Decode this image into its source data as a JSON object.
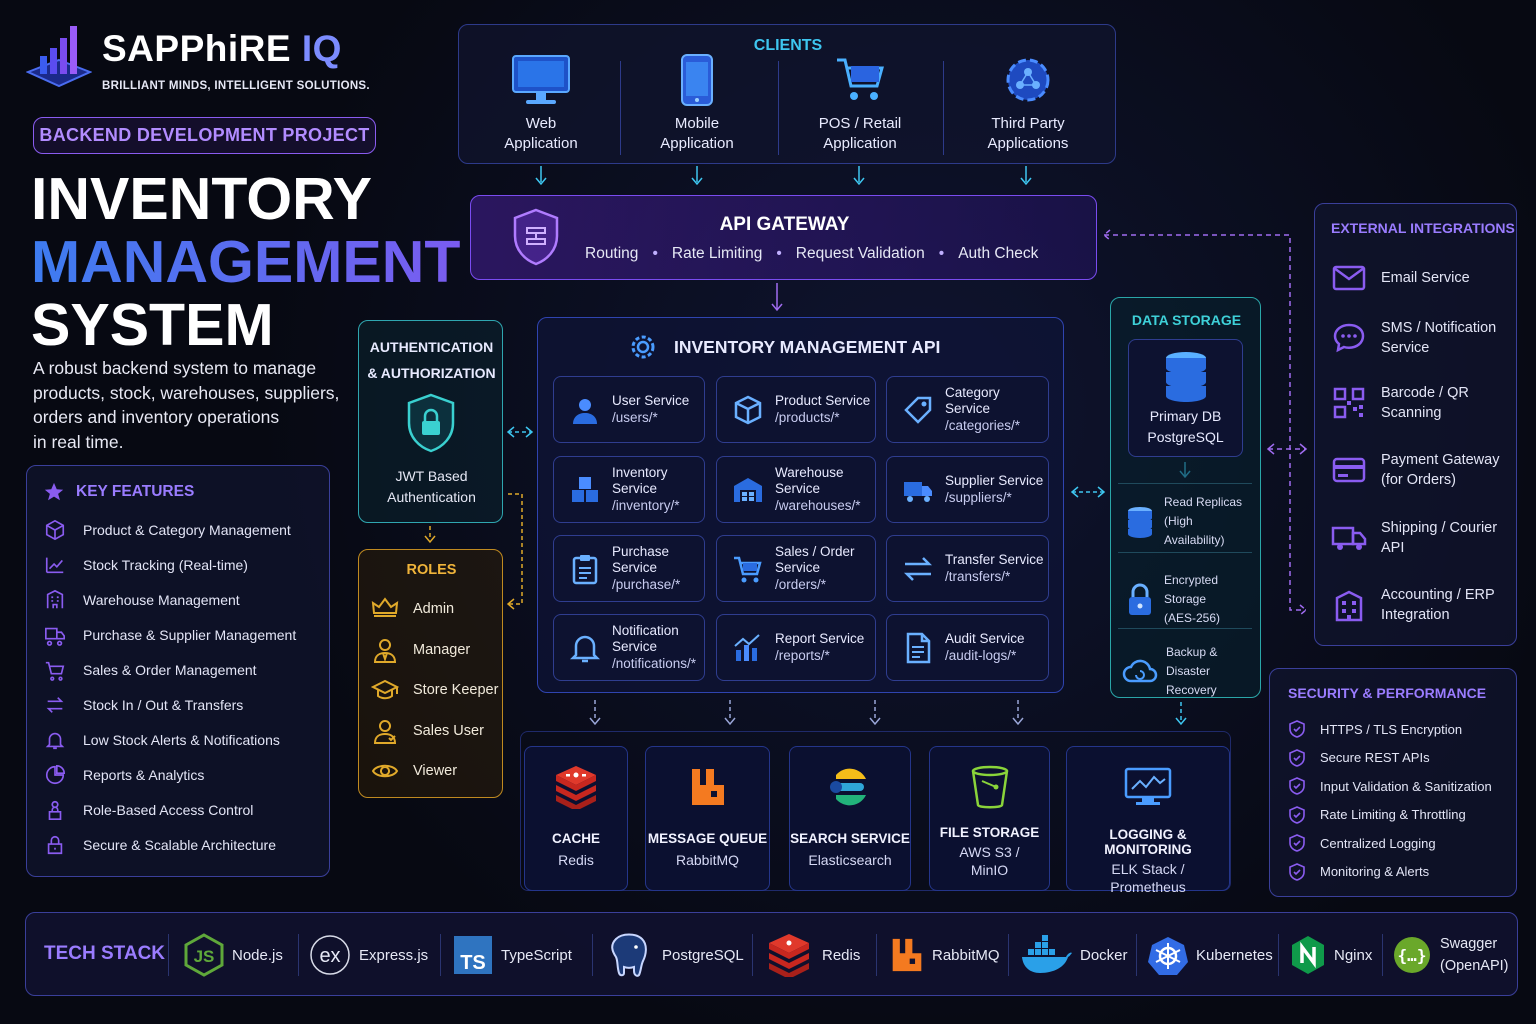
{
  "brand": {
    "name_main": "SAPPhiRE",
    "name_accent": "IQ",
    "tagline": "BRILLIANT MINDS, INTELLIGENT SOLUTIONS."
  },
  "project_badge": "BACKEND DEVELOPMENT PROJECT",
  "title": {
    "line1": "INVENTORY",
    "line2": "MANAGEMENT",
    "line3": "SYSTEM"
  },
  "description": [
    "A robust backend system to manage",
    "products, stock, warehouses, suppliers,",
    "orders and inventory operations",
    "in real time."
  ],
  "key_features": {
    "heading": "KEY FEATURES",
    "items": [
      {
        "label": "Product & Category Management",
        "icon": "cube-icon"
      },
      {
        "label": "Stock Tracking (Real-time)",
        "icon": "trend-icon"
      },
      {
        "label": "Warehouse Management",
        "icon": "building-icon"
      },
      {
        "label": "Purchase & Supplier Management",
        "icon": "truck-icon"
      },
      {
        "label": "Sales & Order Management",
        "icon": "cart-icon"
      },
      {
        "label": "Stock In / Out & Transfers",
        "icon": "transfer-icon"
      },
      {
        "label": "Low Stock Alerts & Notifications",
        "icon": "bell-icon"
      },
      {
        "label": "Reports & Analytics",
        "icon": "pie-icon"
      },
      {
        "label": "Role-Based Access Control",
        "icon": "lock-person-icon"
      },
      {
        "label": "Secure & Scalable Architecture",
        "icon": "lock-icon"
      }
    ]
  },
  "clients": {
    "heading": "CLIENTS",
    "items": [
      {
        "line1": "Web",
        "line2": "Application"
      },
      {
        "line1": "Mobile",
        "line2": "Application"
      },
      {
        "line1": "POS / Retail",
        "line2": "Application"
      },
      {
        "line1": "Third Party",
        "line2": "Applications"
      }
    ]
  },
  "api_gateway": {
    "title": "API GATEWAY",
    "features": [
      "Routing",
      "Rate Limiting",
      "Request Validation",
      "Auth Check"
    ]
  },
  "auth": {
    "heading_line1": "AUTHENTICATION",
    "heading_line2": "& AUTHORIZATION",
    "label_line1": "JWT Based",
    "label_line2": "Authentication"
  },
  "roles": {
    "heading": "ROLES",
    "items": [
      "Admin",
      "Manager",
      "Store Keeper",
      "Sales User",
      "Viewer"
    ]
  },
  "inventory_api": {
    "title": "INVENTORY MANAGEMENT API",
    "services": [
      {
        "name": "User Service",
        "path": "/users/*"
      },
      {
        "name": "Product Service",
        "path": "/products/*"
      },
      {
        "name": "Category Service",
        "path": "/categories/*"
      },
      {
        "name": "Inventory Service",
        "path": "/inventory/*"
      },
      {
        "name": "Warehouse Service",
        "path": "/warehouses/*"
      },
      {
        "name": "Supplier Service",
        "path": "/suppliers/*"
      },
      {
        "name": "Purchase Service",
        "path": "/purchase/*"
      },
      {
        "name": "Sales / Order Service",
        "path": "/orders/*"
      },
      {
        "name": "Transfer Service",
        "path": "/transfers/*"
      },
      {
        "name": "Notification Service",
        "path": "/notifications/*"
      },
      {
        "name": "Report Service",
        "path": "/reports/*"
      },
      {
        "name": "Audit Service",
        "path": "/audit-logs/*"
      }
    ]
  },
  "data_storage": {
    "heading": "DATA STORAGE",
    "primary_line1": "Primary DB",
    "primary_line2": "PostgreSQL",
    "items": [
      {
        "line1": "Read Replicas",
        "line2": "(High Availability)"
      },
      {
        "line1": "Encrypted Storage",
        "line2": "(AES-256)"
      },
      {
        "line1": "Backup &",
        "line2": "Disaster Recovery"
      }
    ]
  },
  "external": {
    "heading": "EXTERNAL INTEGRATIONS",
    "items": [
      {
        "line1": "Email Service",
        "line2": ""
      },
      {
        "line1": "SMS / Notification",
        "line2": "Service"
      },
      {
        "line1": "Barcode  / QR",
        "line2": "Scanning"
      },
      {
        "line1": "Payment Gateway",
        "line2": "(for Orders)"
      },
      {
        "line1": "Shipping / Courier",
        "line2": "API"
      },
      {
        "line1": "Accounting / ERP",
        "line2": "Integration"
      }
    ]
  },
  "security": {
    "heading": "SECURITY & PERFORMANCE",
    "items": [
      "HTTPS / TLS Encryption",
      "Secure REST APIs",
      "Input Validation & Sanitization",
      "Rate Limiting & Throttling",
      "Centralized Logging",
      "Monitoring & Alerts"
    ]
  },
  "infra": [
    {
      "name": "CACHE",
      "value_line1": "Redis",
      "value_line2": ""
    },
    {
      "name": "MESSAGE QUEUE",
      "value_line1": "RabbitMQ",
      "value_line2": ""
    },
    {
      "name": "SEARCH SERVICE",
      "value_line1": "Elasticsearch",
      "value_line2": ""
    },
    {
      "name": "FILE STORAGE",
      "value_line1": "AWS S3 /",
      "value_line2": "MinIO"
    },
    {
      "name": "LOGGING & MONITORING",
      "value_line1": "ELK Stack /",
      "value_line2": "Prometheus"
    }
  ],
  "tech_stack": {
    "heading": "TECH STACK",
    "items": [
      "Node.js",
      "Express.js",
      "TypeScript",
      "PostgreSQL",
      "Redis",
      "RabbitMQ",
      "Docker",
      "Kubernetes",
      "Nginx",
      "Swagger",
      "(OpenAPI)"
    ]
  },
  "colors": {
    "accent_purple": "#9a7cff",
    "accent_cyan": "#3ec6f0",
    "roles_gold": "#e0a92a",
    "panel_border": "#2d3a8a"
  }
}
